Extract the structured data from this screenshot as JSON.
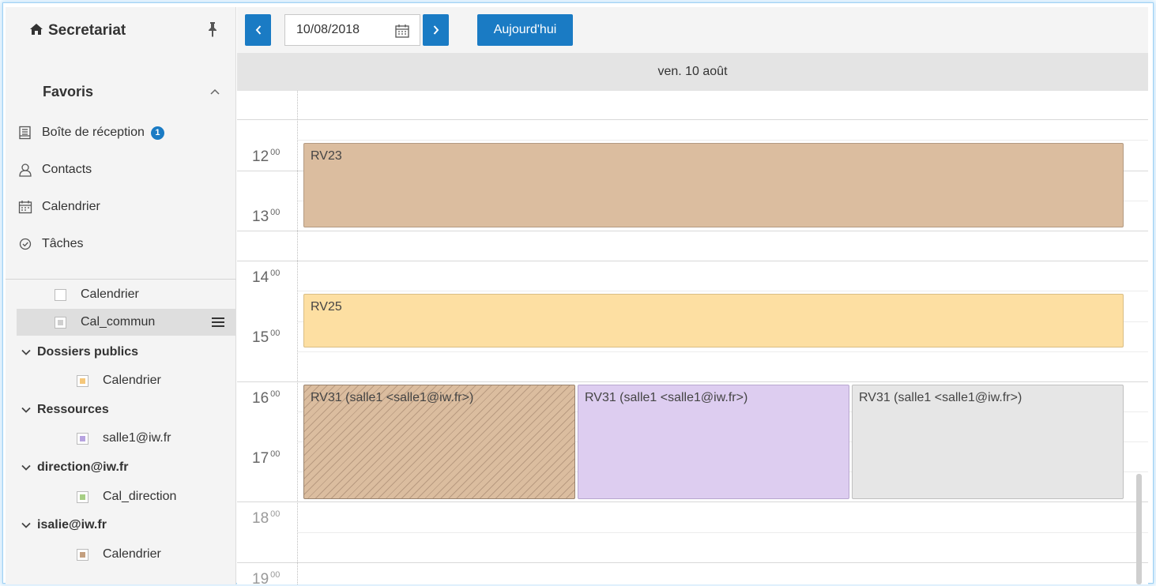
{
  "sidebar": {
    "title": "Secretariat",
    "favorites_title": "Favoris",
    "nav": [
      {
        "label": "Boîte de réception",
        "badge": "1"
      },
      {
        "label": "Contacts"
      },
      {
        "label": "Calendrier"
      },
      {
        "label": "Tâches"
      }
    ],
    "tree": {
      "cal_perso": "Calendrier",
      "cal_commun": "Cal_commun",
      "group_public": "Dossiers publics",
      "public_cal": "Calendrier",
      "group_resources": "Ressources",
      "resource_salle1": "salle1@iw.fr",
      "group_direction": "direction@iw.fr",
      "direction_cal": "Cal_direction",
      "group_isalie": "isalie@iw.fr",
      "isalie_cal": "Calendrier"
    }
  },
  "toolbar": {
    "date_value": "10/08/2018",
    "today_label": "Aujourd'hui"
  },
  "calendar": {
    "day_header": "ven. 10 août",
    "hours": [
      {
        "h": "12",
        "m": "00"
      },
      {
        "h": "13",
        "m": "00"
      },
      {
        "h": "14",
        "m": "00"
      },
      {
        "h": "15",
        "m": "00"
      },
      {
        "h": "16",
        "m": "00"
      },
      {
        "h": "17",
        "m": "00"
      },
      {
        "h": "18",
        "m": "00"
      },
      {
        "h": "19",
        "m": "00"
      }
    ],
    "events": {
      "rv23": "RV23",
      "rv25": "RV25",
      "rv31_a": "RV31 (salle1 <salle1@iw.fr>)",
      "rv31_b": "RV31 (salle1 <salle1@iw.fr>)",
      "rv31_c": "RV31 (salle1 <salle1@iw.fr>)"
    }
  },
  "colors": {
    "accent": "#1a7bc4",
    "event_brown": "#dbbd9f",
    "event_yellow": "#fddfa2",
    "event_purple": "#ddcdf0",
    "event_grey": "#e6e6e6",
    "cal_yellow": "#f5c77a",
    "cal_purple": "#b7a3e0",
    "cal_green": "#a7cf85",
    "cal_brown": "#c4a080"
  }
}
